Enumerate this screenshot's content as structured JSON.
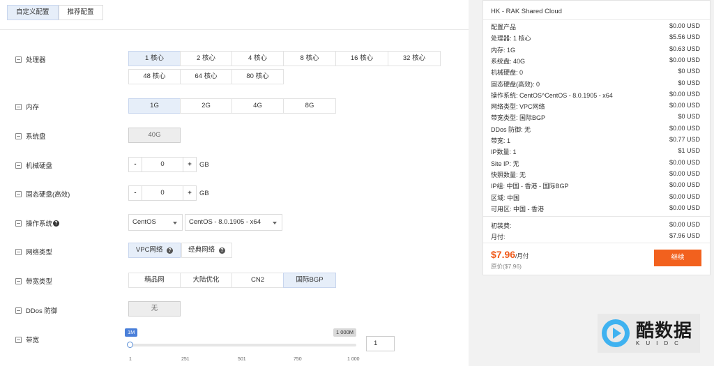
{
  "tabs": [
    "自定义配置",
    "推荐配置"
  ],
  "rows": {
    "cpu": {
      "label": "处理器",
      "options": [
        "1 核心",
        "2 核心",
        "4 核心",
        "8 核心",
        "16 核心",
        "32 核心",
        "48 核心",
        "64 核心",
        "80 核心"
      ]
    },
    "memory": {
      "label": "内存",
      "options": [
        "1G",
        "2G",
        "4G",
        "8G"
      ]
    },
    "system_disk": {
      "label": "系统盘",
      "value": "40G"
    },
    "hdd": {
      "label": "机械硬盘",
      "minus": "-",
      "plus": "+",
      "value": "0",
      "unit": "GB"
    },
    "ssd": {
      "label": "固态硬盘(高效)",
      "minus": "-",
      "plus": "+",
      "value": "0",
      "unit": "GB"
    },
    "os": {
      "label": "操作系统",
      "help": "?",
      "family": "CentOS",
      "version": "CentOS - 8.0.1905 - x64"
    },
    "network": {
      "label": "网络类型",
      "options": [
        "VPC网络",
        "经典网络"
      ],
      "help": "?"
    },
    "bandwidth_type": {
      "label": "带宽类型",
      "options": [
        "精品网",
        "大陆优化",
        "CN2",
        "国际BGP"
      ]
    },
    "ddos": {
      "label": "DDos 防御",
      "value": "无"
    },
    "bandwidth": {
      "label": "带宽",
      "min_tag": "1M",
      "max_tag": "1 000M",
      "value": "1",
      "current": 1,
      "min": 1,
      "max": 1000,
      "ticks": [
        "1",
        "251",
        "501",
        "750",
        "1 000"
      ]
    }
  },
  "summary": {
    "title": "HK - RAK Shared Cloud",
    "items": [
      {
        "label": "配置产品",
        "price": "$0.00 USD"
      },
      {
        "label": "处理器: 1 核心",
        "price": "$5.56 USD"
      },
      {
        "label": "内存: 1G",
        "price": "$0.63 USD"
      },
      {
        "label": "系统盘: 40G",
        "price": "$0.00 USD"
      },
      {
        "label": "机械硬盘: 0",
        "price": "$0 USD"
      },
      {
        "label": "固态硬盘(高效): 0",
        "price": "$0 USD"
      },
      {
        "label": "操作系统: CentOS^CentOS - 8.0.1905 - x64",
        "price": "$0.00 USD"
      },
      {
        "label": "网络类型: VPC网络",
        "price": "$0.00 USD"
      },
      {
        "label": "带宽类型: 国际BGP",
        "price": "$0 USD"
      },
      {
        "label": "DDos 防御: 无",
        "price": "$0.00 USD"
      },
      {
        "label": "带宽: 1",
        "price": "$0.77 USD"
      },
      {
        "label": "IP数量: 1",
        "price": "$1 USD"
      },
      {
        "label": "Site IP: 无",
        "price": "$0.00 USD"
      },
      {
        "label": "快照数量: 无",
        "price": "$0.00 USD"
      },
      {
        "label": "IP组: 中国 - 香港 - 国际BGP",
        "price": "$0.00 USD"
      },
      {
        "label": "区域: 中国",
        "price": "$0.00 USD"
      },
      {
        "label": "可用区: 中国 - 香港",
        "price": "$0.00 USD"
      }
    ],
    "setup_label": "初装费:",
    "setup_price": "$0.00 USD",
    "monthly_label": "月付:",
    "monthly_price": "$7.96 USD",
    "total": "$7.96",
    "total_unit": "/月付",
    "original": "原价($7.96)",
    "continue": "继续"
  },
  "watermark": {
    "big": "酷数据",
    "sub": "KUIDC"
  },
  "colors": {
    "accent": "#f2611e",
    "selected_bg": "#e6eef9",
    "tag_blue": "#4a7fd9"
  }
}
